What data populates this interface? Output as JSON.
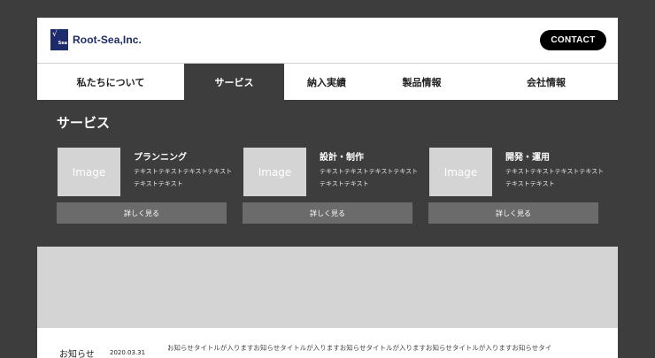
{
  "header": {
    "logo_text": "Root-Sea,Inc.",
    "logo_mark_symbol": "√",
    "logo_mark_sub": "Sea",
    "contact_label": "CONTACT"
  },
  "nav": {
    "items": [
      {
        "label": "私たちについて",
        "active": false
      },
      {
        "label": "サービス",
        "active": true
      },
      {
        "label": "納入実績",
        "active": false
      },
      {
        "label": "製品情報",
        "active": false
      },
      {
        "label": "会社情報",
        "active": false
      }
    ]
  },
  "panel": {
    "title": "サービス",
    "cards": [
      {
        "image_label": "Image",
        "title": "プランニング",
        "text": "テキストテキストテキストテキストテキストテキスト",
        "button": "詳しく見る"
      },
      {
        "image_label": "Image",
        "title": "設計・制作",
        "text": "テキストテキストテキストテキストテキストテキスト",
        "button": "詳しく見る"
      },
      {
        "image_label": "Image",
        "title": "開発・運用",
        "text": "テキストテキストテキストテキストテキストテキスト",
        "button": "詳しく見る"
      }
    ]
  },
  "news": {
    "label": "お知らせ",
    "date": "2020.03.31",
    "text": "お知らせタイトルが入りますお知らせタイトルが入りますお知らせタイトルが入りますお知らせタイトルが入りますお知らせタイ"
  },
  "colors": {
    "background": "#3d3d3d",
    "brand": "#1d2a6b",
    "panel": "#3d3d3d",
    "placeholder": "#d4d4d4",
    "button": "#6b6b6b"
  }
}
